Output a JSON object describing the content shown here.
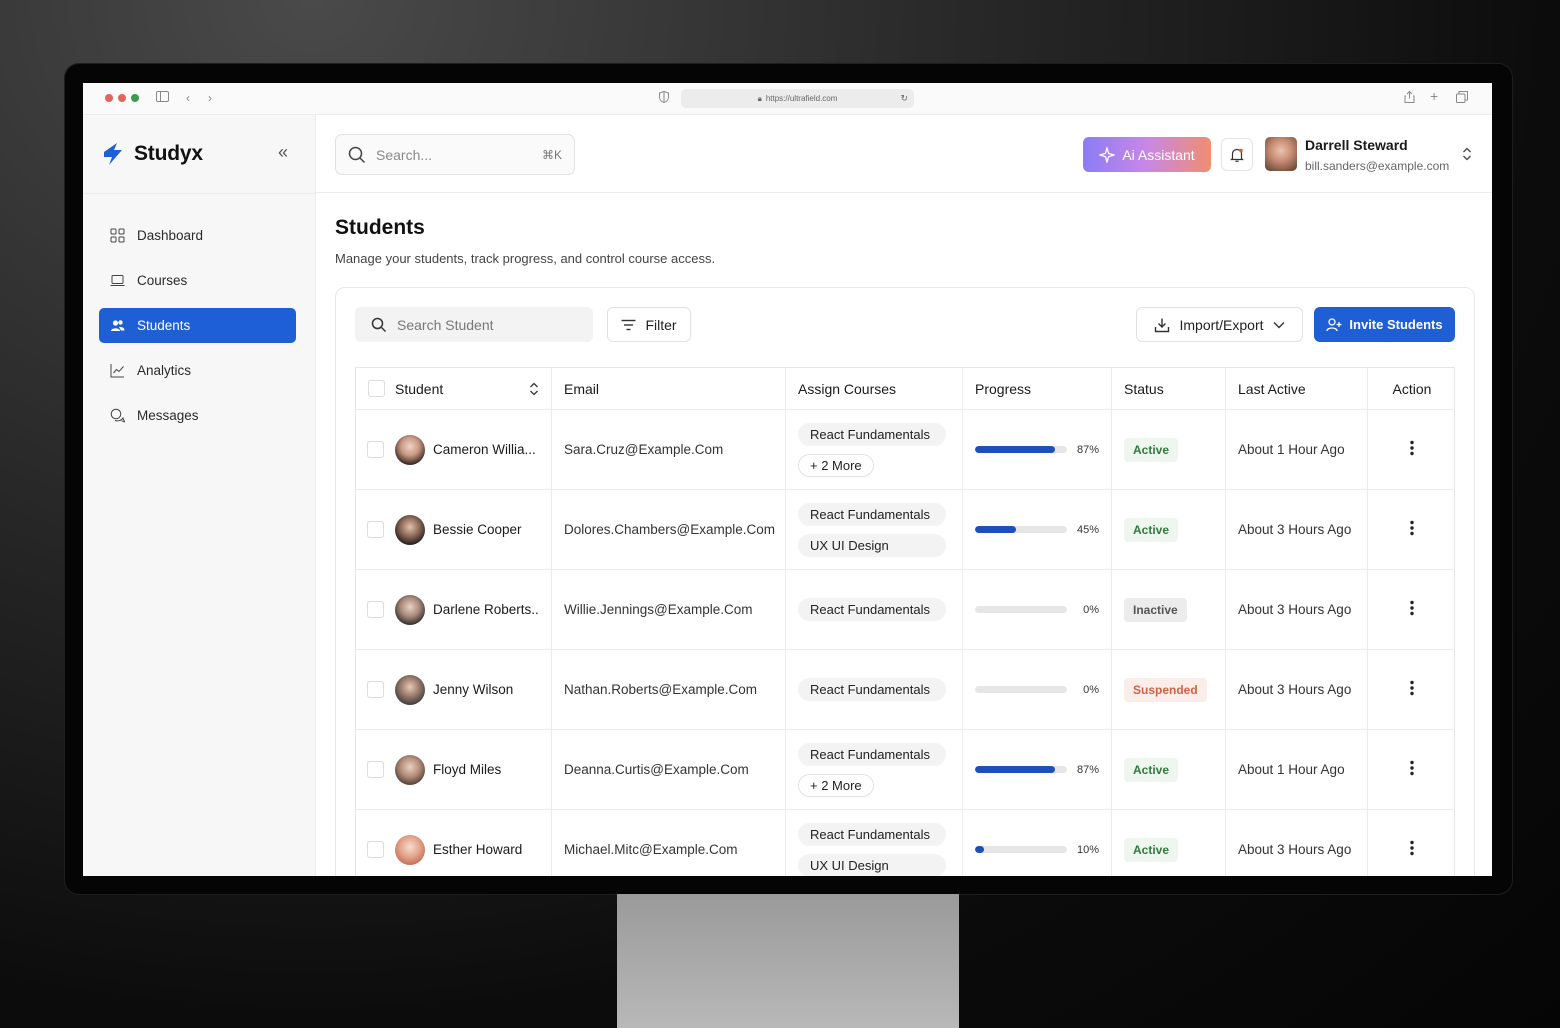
{
  "browser": {
    "url": "https://ultrafield.com",
    "traffic_colors": [
      "#e0655b",
      "#e0655b",
      "#3f9a50"
    ]
  },
  "sidebar": {
    "logo_text": "Studyx",
    "items": [
      {
        "label": "Dashboard",
        "icon": "grid-icon",
        "active": false
      },
      {
        "label": "Courses",
        "icon": "laptop-icon",
        "active": false
      },
      {
        "label": "Students",
        "icon": "users-icon",
        "active": true
      },
      {
        "label": "Analytics",
        "icon": "chart-line-icon",
        "active": false
      },
      {
        "label": "Messages",
        "icon": "chat-icon",
        "active": false
      }
    ]
  },
  "header": {
    "search_placeholder": "Search...",
    "search_shortcut": "⌘K",
    "ai_button": "Ai Assistant",
    "user_name": "Darrell Steward",
    "user_email": "bill.sanders@example.com"
  },
  "page": {
    "title": "Students",
    "subtitle": "Manage your students, track progress, and control course access."
  },
  "toolbar": {
    "search_placeholder": "Search Student",
    "filter_label": "Filter",
    "import_label": "Import/Export",
    "invite_label": "Invite Students"
  },
  "table": {
    "headers": [
      "Student",
      "Email",
      "Assign Courses",
      "Progress",
      "Status",
      "Last Active",
      "Action"
    ],
    "rows": [
      {
        "name": "Cameron Willia...",
        "email": "Sara.Cruz@Example.Com",
        "courses": [
          "React Fundamentals"
        ],
        "more": "+ 2 More",
        "progress": 87,
        "progress_label": "87%",
        "status": "Active",
        "status_kind": "active",
        "last_active": "About 1 Hour Ago"
      },
      {
        "name": "Bessie Cooper",
        "email": "Dolores.Chambers@Example.Com",
        "courses": [
          "React Fundamentals",
          "UX UI Design"
        ],
        "more": "",
        "progress": 45,
        "progress_label": "45%",
        "status": "Active",
        "status_kind": "active",
        "last_active": "About 3 Hours Ago"
      },
      {
        "name": "Darlene Roberts..",
        "email": "Willie.Jennings@Example.Com",
        "courses": [
          "React Fundamentals"
        ],
        "more": "",
        "progress": 0,
        "progress_label": "0%",
        "status": "Inactive",
        "status_kind": "inactive",
        "last_active": "About 3 Hours Ago"
      },
      {
        "name": "Jenny Wilson",
        "email": "Nathan.Roberts@Example.Com",
        "courses": [
          "React Fundamentals"
        ],
        "more": "",
        "progress": 0,
        "progress_label": "0%",
        "status": "Suspended",
        "status_kind": "suspended",
        "last_active": "About 3 Hours Ago"
      },
      {
        "name": "Floyd Miles",
        "email": "Deanna.Curtis@Example.Com",
        "courses": [
          "React Fundamentals"
        ],
        "more": "+ 2 More",
        "progress": 87,
        "progress_label": "87%",
        "status": "Active",
        "status_kind": "active",
        "last_active": "About 1 Hour Ago"
      },
      {
        "name": "Esther Howard",
        "email": "Michael.Mitc@Example.Com",
        "courses": [
          "React Fundamentals",
          "UX UI Design"
        ],
        "more": "",
        "progress": 10,
        "progress_label": "10%",
        "status": "Active",
        "status_kind": "active",
        "last_active": "About 3 Hours Ago"
      }
    ]
  },
  "colors": {
    "accent": "#1f5fd6",
    "progress_fill": "#1f4fba",
    "active": "#2f7a3e",
    "suspended": "#d06345"
  }
}
